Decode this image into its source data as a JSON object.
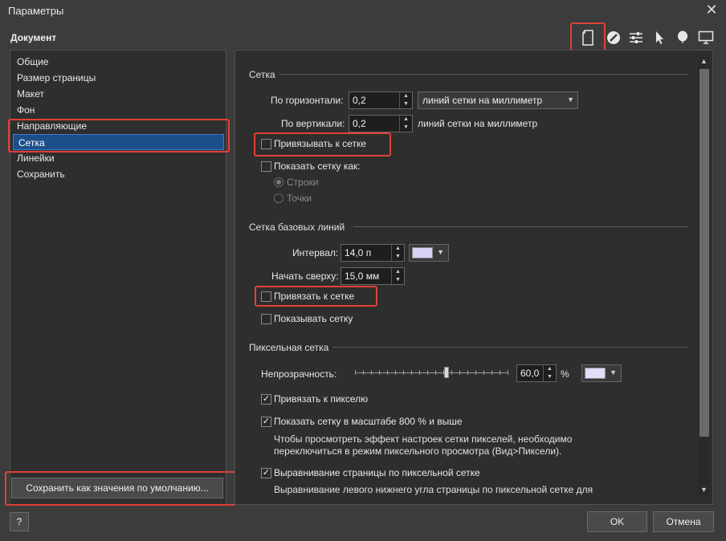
{
  "window": {
    "title": "Параметры",
    "close_glyph": "✕"
  },
  "section_title": "Документ",
  "toolbar": {
    "icons": [
      "document-icon",
      "pen-nib-icon",
      "sliders-icon",
      "pointer-icon",
      "balloon-icon",
      "monitor-icon"
    ]
  },
  "nav": {
    "items": [
      "Общие",
      "Размер страницы",
      "Макет",
      "Фон",
      "Направляющие",
      "Сетка",
      "Линейки",
      "Сохранить"
    ],
    "selected": "Сетка"
  },
  "left_button": "Сохранить как значения по умолчанию...",
  "help_button": "?",
  "ok_button": "OK",
  "cancel_button": "Отмена",
  "grid": {
    "title": "Сетка",
    "horizontal_label": "По горизонтали:",
    "horizontal_value": "0,2",
    "unit_dropdown": "линий сетки на миллиметр",
    "vertical_label": "По вертикали:",
    "vertical_value": "0,2",
    "vertical_unit": "линий сетки на миллиметр",
    "snap_label": "Привязывать к сетке",
    "show_as_label": "Показать сетку как:",
    "radio_rows": "Строки",
    "radio_dots": "Точки"
  },
  "baseline": {
    "title": "Сетка базовых линий",
    "interval_label": "Интервал:",
    "interval_value": "14,0 п",
    "start_label": "Начать сверху:",
    "start_value": "15,0 мм",
    "snap_label": "Привязать к сетке",
    "show_label": "Показывать сетку",
    "color": "#d8d2f6"
  },
  "pixel": {
    "title": "Пиксельная сетка",
    "opacity_label": "Непрозрачность:",
    "opacity_value": "60,0",
    "opacity_unit": "%",
    "opacity_level": 0.6,
    "snap_label": "Привязать к пикселю",
    "show800_label": "Показать сетку в масштабе 800 % и выше",
    "note1": "Чтобы просмотреть эффект настроек сетки пикселей, необходимо",
    "note2": "переключиться в режим пиксельного просмотра (Вид>Пиксели).",
    "align_label": "Выравнивание страницы по пиксельной сетке",
    "align_desc": "Выравнивание левого нижнего угла страницы по пиксельной сетке для",
    "color": "#e2ddf8"
  },
  "check_glyph": "✓",
  "colors": {
    "highlight": "#e0413a",
    "selected_bg": "#1c4f8a"
  }
}
